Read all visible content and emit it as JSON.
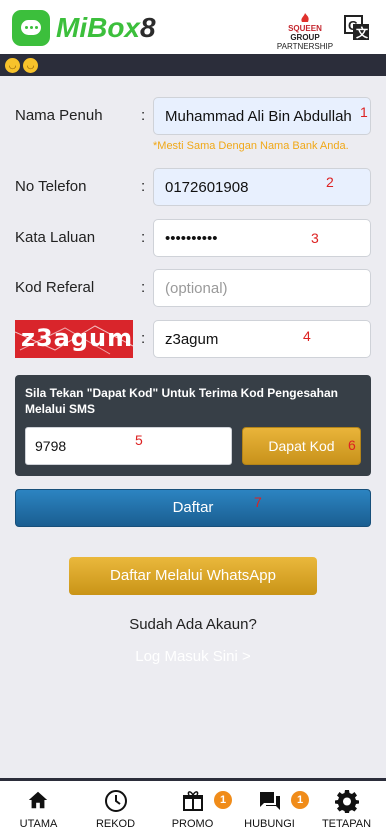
{
  "header": {
    "logo_brand": "MiBox",
    "logo_number": "8",
    "partner_line1": "SQUEEN",
    "partner_line2": "GROUP",
    "partner_line3": "PARTNERSHIP"
  },
  "form": {
    "nama_label": "Nama Penuh",
    "nama_value": "Muhammad Ali Bin Abdullah",
    "nama_hint": "*Mesti Sama Dengan Nama Bank Anda.",
    "telefon_label": "No Telefon",
    "telefon_value": "0172601908",
    "laluan_label": "Kata Laluan",
    "laluan_value": "••••••••••",
    "referal_label": "Kod Referal",
    "referal_placeholder": "(optional)",
    "captcha_text": "z3agum",
    "captcha_value": "z3agum",
    "colon": ":"
  },
  "annotations": [
    "1",
    "2",
    "3",
    "4",
    "5",
    "6",
    "7"
  ],
  "sms": {
    "title": "Sila Tekan \"Dapat Kod\" Untuk Terima Kod Pengesahan Melalui SMS",
    "code_value": "9798",
    "get_code_label": "Dapat Kod"
  },
  "buttons": {
    "register_label": "Daftar",
    "whatsapp_label": "Daftar Melalui WhatsApp"
  },
  "footer_text": {
    "have_account": "Sudah Ada Akaun?",
    "login_link": "Log Masuk Sini >"
  },
  "nav": {
    "items": [
      {
        "label": "UTAMA",
        "icon": "home-icon"
      },
      {
        "label": "REKOD",
        "icon": "clock-icon"
      },
      {
        "label": "PROMO",
        "icon": "gift-icon",
        "badge": "1"
      },
      {
        "label": "HUBUNGI",
        "icon": "chat-icon",
        "badge": "1"
      },
      {
        "label": "TETAPAN",
        "icon": "gear-icon"
      }
    ]
  },
  "colors": {
    "brand_green": "#3cbf3c",
    "dark_bar": "#2b2d3a",
    "hint_orange": "#f0a818",
    "button_blue": "#1f6fa8",
    "button_gold": "#d9a22a",
    "annotation_red": "#d22222"
  }
}
